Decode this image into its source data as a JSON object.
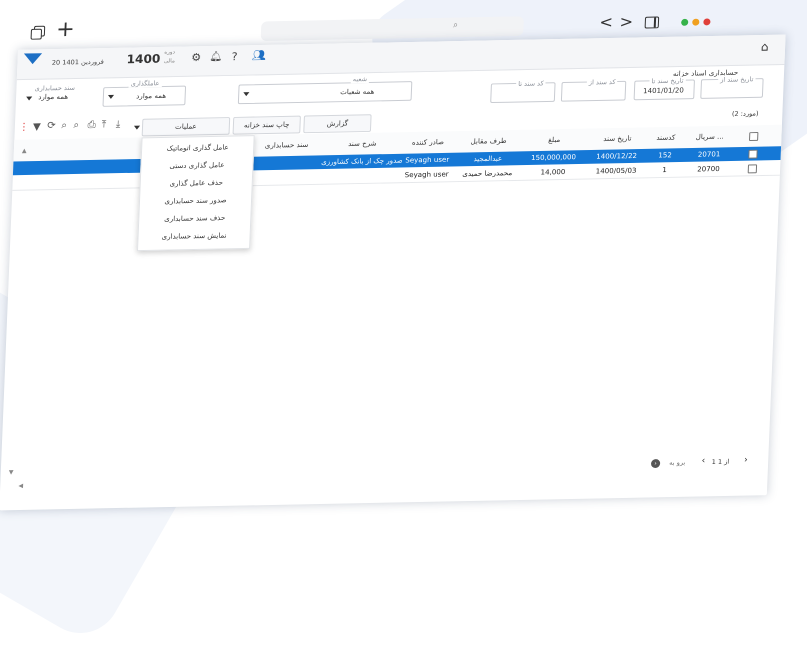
{
  "browser": {
    "tabs_icon": "tabs-icon",
    "new_tab": "+",
    "address_placeholder": "",
    "nav_back": "<",
    "nav_forward": ">"
  },
  "topbar": {
    "date_text": "20 فروردین 1401",
    "fiscal_label": "دوره",
    "fiscal_sub": "مالی",
    "year": "1400",
    "help": "?"
  },
  "page": {
    "title": "حسابداری اسناد خزانه"
  },
  "filters": {
    "from_date_label": "تاریخ سند از",
    "to_date_label": "تاریخ سند تا",
    "to_date_value": "1401/01/20",
    "doc_no_from_label": "کد سند از",
    "doc_no_to_label": "کد سند تا",
    "branch_label": "شعبه",
    "branch_value": "همه شعبات",
    "operator_label": "عاملگذاری",
    "operator_value": "همه موارد",
    "acc_doc_label": "سند حسابداری",
    "acc_doc_value": "همه موارد"
  },
  "toolbar": {
    "report": "گزارش",
    "print": "چاپ سند خزانه",
    "operations": "عملیات",
    "count_text": "(مورد: 2)"
  },
  "operations_menu": [
    "عامل گذاری اتوماتیک",
    "عامل گذاری دستی",
    "حذف عامل گذاری",
    "صدور سند حسابداری",
    "حذف سند حسابداری",
    "نمایش سند حسابداری"
  ],
  "table": {
    "headers": [
      "سریال ...",
      "کدسند",
      "تاریخ سند",
      "مبلغ",
      "طرف مقابل",
      "صادر کننده",
      "شرح سند",
      "سند حسابداری"
    ],
    "rows": [
      {
        "serial": "20701",
        "code": "152",
        "date": "1400/12/22",
        "amount": "150,000,000",
        "party": "عبدالمجید",
        "issuer": "Seyagh user",
        "desc": "صدور چک از بانک کشاورزی..",
        "acc": "",
        "selected": true
      },
      {
        "serial": "20700",
        "code": "1",
        "date": "1400/05/03",
        "amount": "14,000",
        "party": "محمدرضا حمیدی",
        "issuer": "Seyagh user",
        "desc": "",
        "acc": "",
        "selected": false
      }
    ]
  },
  "footer": {
    "pager": "1 از 1",
    "goto": "برو به"
  },
  "colors": {
    "accent": "#1578d6",
    "close": "#e0403a",
    "min": "#f0a020",
    "max": "#36b24a"
  }
}
